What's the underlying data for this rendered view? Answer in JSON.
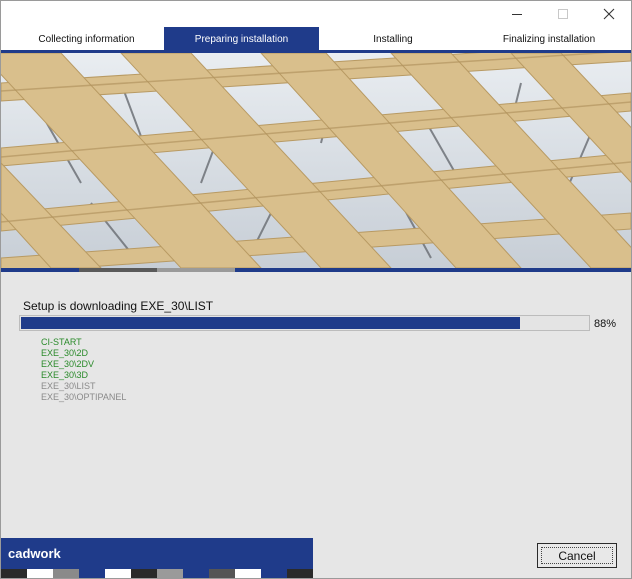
{
  "window": {
    "controls": [
      "minimize-icon",
      "maximize-icon",
      "close-icon"
    ]
  },
  "steps": [
    {
      "label": "Collecting information",
      "active": false
    },
    {
      "label": "Preparing installation",
      "active": true
    },
    {
      "label": "Installing",
      "active": false
    },
    {
      "label": "Finalizing installation",
      "active": false
    }
  ],
  "status": {
    "text": "Setup is downloading EXE_30\\LIST"
  },
  "progress": {
    "value": 0.88,
    "label": "88%"
  },
  "modules": [
    {
      "name": "CI-START",
      "state": "done"
    },
    {
      "name": "EXE_30\\2D",
      "state": "done"
    },
    {
      "name": "EXE_30\\2DV",
      "state": "done"
    },
    {
      "name": "EXE_30\\3D",
      "state": "done"
    },
    {
      "name": "EXE_30\\LIST",
      "state": "pending"
    },
    {
      "name": "EXE_30\\OPTIPANEL",
      "state": "pending"
    }
  ],
  "brand": {
    "name": "cadwork"
  },
  "buttons": {
    "cancel_label": "Cancel"
  },
  "colors": {
    "accent": "#1f3b8a",
    "done_text": "#2a8a2a",
    "pending_text": "#8a8a8a",
    "timber": "#d9bf8c",
    "sky": "#d8dde2"
  }
}
